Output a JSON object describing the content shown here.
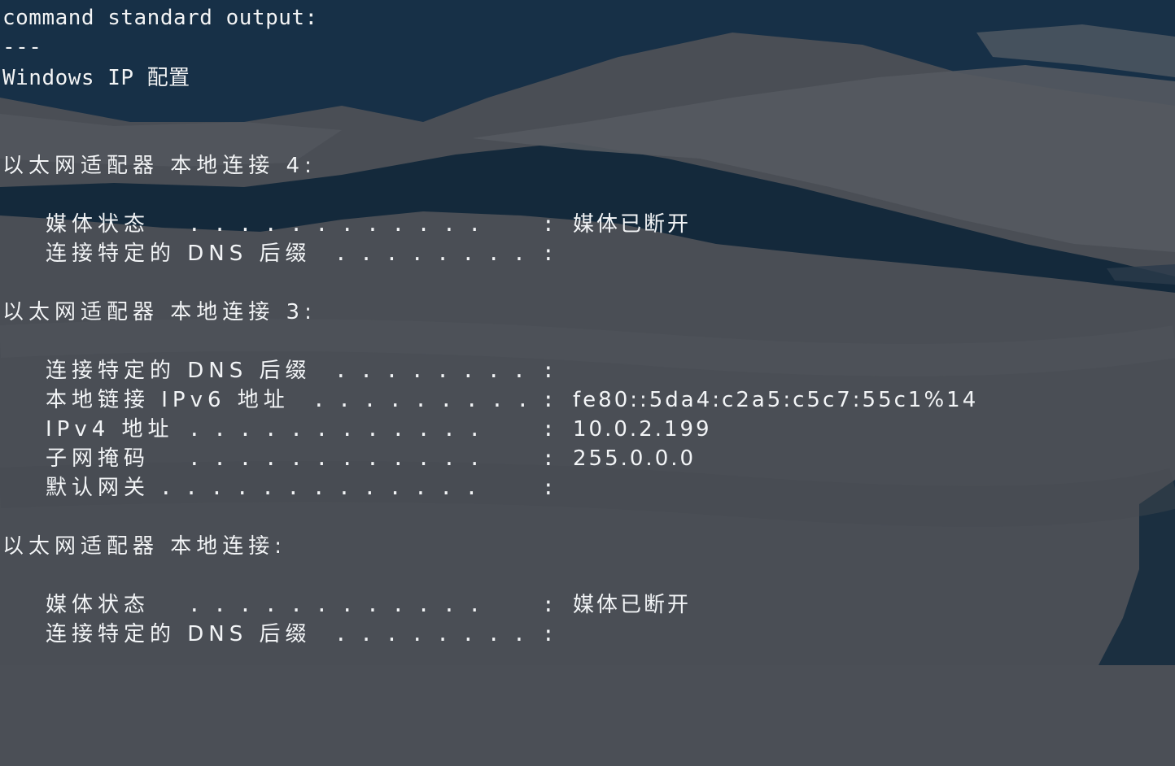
{
  "terminal": {
    "header": "command standard output:",
    "separator": "---",
    "title": "Windows IP 配置",
    "adapter4": {
      "heading": "以太网适配器 本地连接 4:",
      "media_state_label": "媒体状态",
      "media_state_value": "媒体已断开",
      "dns_suffix_label": "连接特定的 DNS 后缀"
    },
    "adapter3": {
      "heading": "以太网适配器 本地连接 3:",
      "dns_suffix_label": "连接特定的 DNS 后缀",
      "ipv6_label": "本地链接 IPv6 地址",
      "ipv6_value": "fe80::5da4:c2a5:c5c7:55c1%14",
      "ipv4_label": "IPv4 地址",
      "ipv4_value": "10.0.2.199",
      "subnet_label": "子网掩码",
      "subnet_value": "255.0.0.0",
      "gateway_label": "默认网关"
    },
    "adapter1": {
      "heading": "以太网适配器 本地连接:",
      "media_state_label": "媒体状态",
      "media_state_value": "媒体已断开",
      "dns_suffix_label": "连接特定的 DNS 后缀"
    },
    "colors": {
      "text": "#f2f4f6",
      "background": "#4b4f56",
      "dark_water": "#13293a"
    }
  }
}
